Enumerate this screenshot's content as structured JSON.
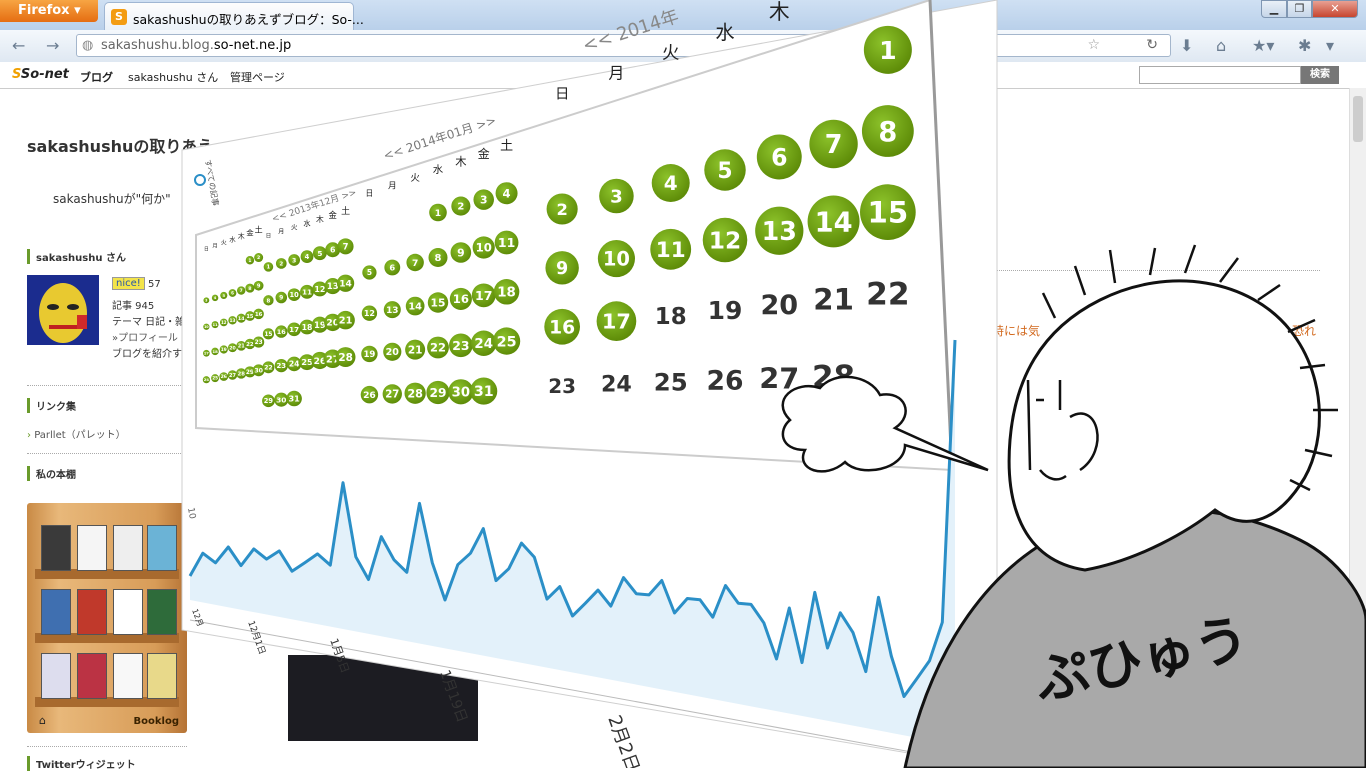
{
  "browser": {
    "app_button": "Firefox",
    "tab_title": "sakashushuの取りあえずブログ：So-...",
    "url_prefix": "sakashushu.blog.",
    "url_domain": "so-net.ne.jp",
    "window_buttons": {
      "minimize": "▁",
      "maximize": "❐",
      "close": "✕"
    },
    "nav_icons": [
      "back-arrow-icon",
      "forward-arrow-icon",
      "download-icon",
      "home-icon",
      "bookmark-star-icon",
      "addon-icon",
      "menu-icon"
    ]
  },
  "bookmarks_bar": {
    "logo_main": "So-net",
    "logo_prefix": "S",
    "blog": "ブログ",
    "user": "sakashushu さん",
    "admin": "管理ページ",
    "search_button": "検索"
  },
  "blog": {
    "title": "sakashushuの取りあえ",
    "description": "sakashushuが\"何か\"",
    "orange_line_left": "時には気",
    "orange_line_right": "する恐れ",
    "sidebar": {
      "profile_head": "sakashushu さん",
      "nice_label": "nice!",
      "nice_count": "57",
      "articles": "記事 945",
      "theme": "テーマ 日記・雑",
      "profile_link": "»プロフィール",
      "introduce": "ブログを紹介す",
      "links_head": "リンク集",
      "link_item": "Parllet（パレット）",
      "bookshelf_head": "私の本棚",
      "bookshelf_brand": "Booklog",
      "twitter_head": "Twitterウィジェット"
    }
  },
  "calendar": {
    "nav_2014_feb": "<< 2014年",
    "nav_2014_jan": "<< 2014年01月 >>",
    "nav_2013_dec": "<< 2013年12月 >>",
    "nav_2013_nov": "<< 2013年11月 >>",
    "weekdays": [
      "日",
      "月",
      "火",
      "水",
      "木",
      "金",
      "土"
    ],
    "feb_green_days": [
      "1",
      "2",
      "3",
      "4",
      "5",
      "6",
      "7",
      "8",
      "9",
      "10",
      "11",
      "12",
      "13",
      "14",
      "15",
      "16",
      "17"
    ],
    "feb_plain_days": [
      "18",
      "19",
      "20",
      "21",
      "22",
      "23",
      "24",
      "25",
      "26",
      "27",
      "28"
    ],
    "jan_green_days": [
      "1",
      "2",
      "3",
      "4",
      "5",
      "6",
      "7",
      "8",
      "9",
      "10",
      "11",
      "12",
      "13",
      "14",
      "15",
      "16",
      "17",
      "18",
      "19",
      "20",
      "21",
      "22",
      "23",
      "24",
      "25",
      "26",
      "27",
      "28",
      "29",
      "30",
      "31"
    ],
    "side_label": "すべての記事",
    "side_label2": "100.0%"
  },
  "chart_labels": {
    "y_top": "10",
    "x_labels": [
      "12月",
      "12月1日",
      "1月5日",
      "1月19日",
      "2月2日"
    ]
  },
  "chart_data": {
    "type": "area",
    "title": "",
    "xlabel": "",
    "ylabel": "",
    "x_tick_labels": [
      "12月",
      "12月1日",
      "1月5日",
      "1月19日",
      "2月2日"
    ],
    "series": [
      {
        "values": [
          3,
          6,
          5,
          7,
          5,
          7,
          6,
          7,
          5,
          6,
          7,
          6,
          14,
          7,
          5,
          9,
          7,
          6,
          12,
          7,
          4,
          7,
          8,
          10,
          6,
          7,
          9,
          8,
          5,
          6,
          4,
          5,
          6,
          5,
          7,
          6,
          6,
          7,
          5,
          6,
          6,
          5,
          7,
          6,
          6,
          5,
          3,
          6,
          3,
          7,
          4,
          6,
          5,
          3,
          7,
          4,
          2,
          3,
          4,
          6,
          20
        ],
        "color": "#2b8fc7"
      }
    ]
  },
  "speech": {
    "comment": "ぷひゅう"
  },
  "colors": {
    "calendar_green": "#6e9c10",
    "chart_line": "#2b8fc7",
    "chart_fill": "#e3f1fa",
    "accent_orange": "#d2691e"
  }
}
